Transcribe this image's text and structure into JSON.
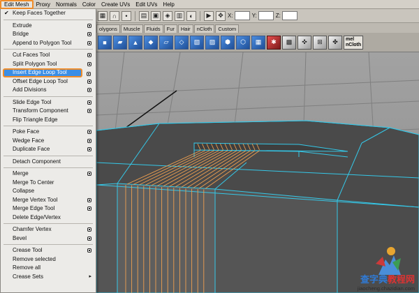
{
  "menu_bar": {
    "items": [
      "Edit Mesh",
      "Proxy",
      "Normals",
      "Color",
      "Create UVs",
      "Edit UVs",
      "Help"
    ],
    "active": "Edit Mesh"
  },
  "status_line": {
    "x_label": "X:",
    "y_label": "Y:",
    "z_label": "Z:"
  },
  "shelf_tabs": [
    "olygons",
    "Muscle",
    "Fluids",
    "Fur",
    "Hair",
    "nCloth",
    "Custom"
  ],
  "shelf_mel": {
    "top": "mel",
    "bottom": "nCloth"
  },
  "edit_mesh_menu": {
    "sections": [
      [
        {
          "label": "Keep Faces Together",
          "checked": true
        }
      ],
      [
        {
          "label": "Extrude",
          "option": true
        },
        {
          "label": "Bridge",
          "option": true
        },
        {
          "label": "Append to Polygon Tool",
          "option": true
        }
      ],
      [
        {
          "label": "Cut Faces Tool",
          "option": true
        },
        {
          "label": "Split Polygon Tool",
          "option": true
        },
        {
          "label": "Insert Edge Loop Tool",
          "option": true,
          "highlighted": true
        },
        {
          "label": "Offset Edge Loop Tool",
          "option": true
        },
        {
          "label": "Add Divisions",
          "option": true
        }
      ],
      [
        {
          "label": "Slide Edge Tool",
          "option": true
        },
        {
          "label": "Transform Component",
          "option": true
        },
        {
          "label": "Flip Triangle Edge"
        }
      ],
      [
        {
          "label": "Poke Face",
          "option": true
        },
        {
          "label": "Wedge Face",
          "option": true
        },
        {
          "label": "Duplicate Face",
          "option": true
        }
      ],
      [
        {
          "label": "Detach Component"
        }
      ],
      [
        {
          "label": "Merge",
          "option": true
        },
        {
          "label": "Merge To Center"
        },
        {
          "label": "Collapse"
        },
        {
          "label": "Merge Vertex Tool",
          "option": true
        },
        {
          "label": "Merge Edge Tool",
          "option": true
        },
        {
          "label": "Delete Edge/Vertex"
        }
      ],
      [
        {
          "label": "Chamfer Vertex",
          "option": true
        },
        {
          "label": "Bevel",
          "option": true
        }
      ],
      [
        {
          "label": "Crease Tool",
          "option": true
        },
        {
          "label": "Remove selected"
        },
        {
          "label": "Remove all"
        },
        {
          "label": "Crease Sets",
          "submenu": true
        }
      ]
    ]
  },
  "watermark": {
    "site_a": "查字典",
    "site_b": "教程网",
    "url": "jiaocheng.chazidian.com"
  },
  "colors": {
    "highlight": "#3a8ee6",
    "callout": "#f08c28",
    "wire": "#35c8e8",
    "edge_loop": "#f0a050"
  }
}
